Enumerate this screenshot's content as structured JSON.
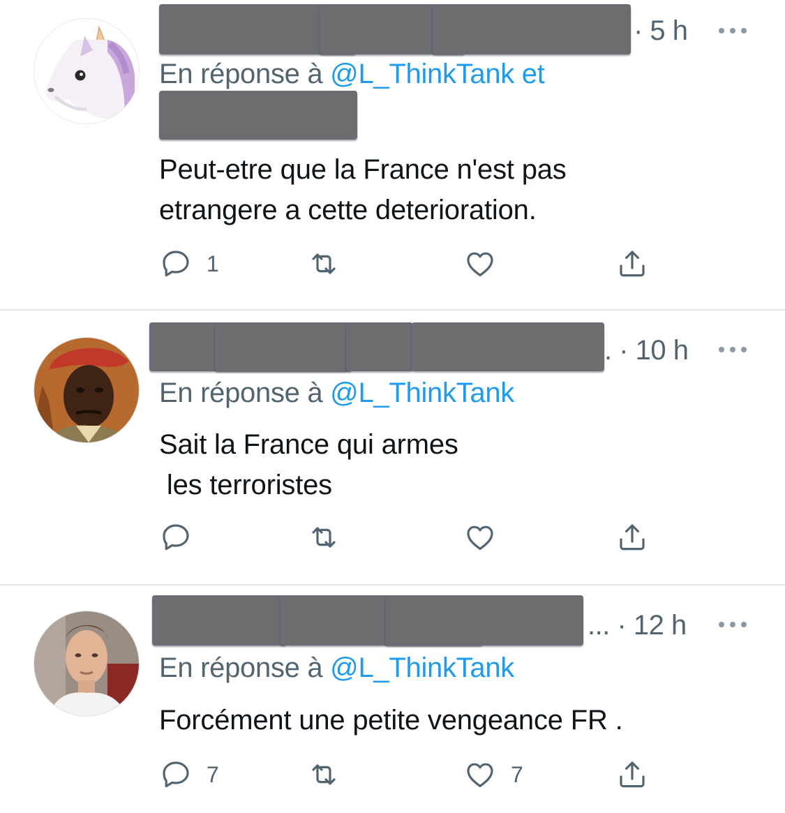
{
  "colors": {
    "accent": "#1d9bf0",
    "secondary_text": "#536471",
    "redaction": "#6d6d6f",
    "divider": "#e4e7ea"
  },
  "tweets": [
    {
      "avatar": "unicorn-avatar",
      "time": "· 5 h",
      "reply_prefix": "En réponse à ",
      "reply_handles": "@L_ThinkTank et",
      "text": "Peut-etre que la France n'est pas\netrangere a cette deterioration.",
      "actions": {
        "reply_count": "1",
        "retweet_count": "",
        "like_count": ""
      }
    },
    {
      "avatar": "beret-man-avatar",
      "time": ". · 10 h",
      "reply_prefix": "En réponse à ",
      "reply_handles": "@L_ThinkTank",
      "text": "Sait la France qui armes\n les terroristes",
      "actions": {
        "reply_count": "",
        "retweet_count": "",
        "like_count": ""
      }
    },
    {
      "avatar": "footballer-avatar",
      "time": "... · 12 h",
      "reply_prefix": "En réponse à ",
      "reply_handles": "@L_ThinkTank",
      "text": "Forcément une petite vengeance FR .",
      "actions": {
        "reply_count": "7",
        "retweet_count": "",
        "like_count": "7"
      }
    }
  ],
  "icons": {
    "reply": "reply-icon",
    "retweet": "retweet-icon",
    "like": "heart-icon",
    "share": "share-icon",
    "more": "more-icon"
  }
}
